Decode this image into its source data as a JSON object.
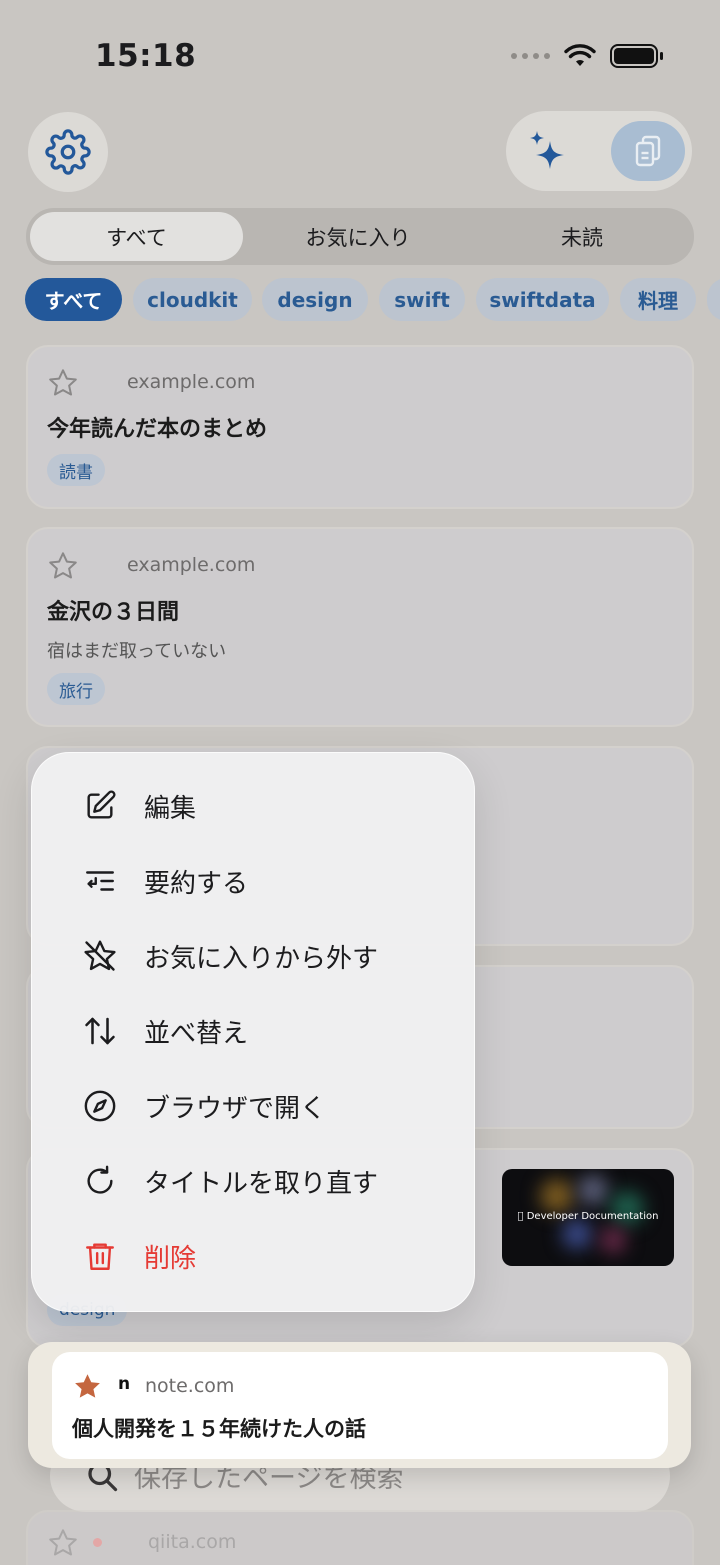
{
  "status": {
    "time": "15:18"
  },
  "segments": [
    "すべて",
    "お気に入り",
    "未読"
  ],
  "chips": [
    "すべて",
    "cloudkit",
    "design",
    "swift",
    "swiftdata",
    "料理"
  ],
  "cards": [
    {
      "domain": "example.com",
      "title": "今年読んだ本のまとめ",
      "description": "",
      "tag": "読書"
    },
    {
      "domain": "example.com",
      "title": "金沢の３日間",
      "description": "宿はまだ取っていない",
      "tag": "旅行"
    }
  ],
  "background_visible_tag": "design",
  "thumbnail": {
    "text": "Developer Documentation"
  },
  "menu": {
    "items": [
      {
        "label": "編集",
        "icon": "edit-icon"
      },
      {
        "label": "要約する",
        "icon": "summarize-icon"
      },
      {
        "label": "お気に入りから外す",
        "icon": "unfavorite-icon"
      },
      {
        "label": "並べ替え",
        "icon": "sort-icon"
      },
      {
        "label": "ブラウザで開く",
        "icon": "compass-icon"
      },
      {
        "label": "タイトルを取り直す",
        "icon": "refresh-icon"
      },
      {
        "label": "削除",
        "icon": "trash-icon"
      }
    ]
  },
  "lifted_card": {
    "domain": "note.com",
    "site_logo": "n",
    "title": "個人開発を１５年続けた人の話"
  },
  "search": {
    "placeholder": "保存したページを検索"
  },
  "bottom_card": {
    "domain": "qiita.com"
  },
  "colors": {
    "accent": "#23589a",
    "danger": "#e53a34",
    "favorite_star": "#c4663f"
  }
}
